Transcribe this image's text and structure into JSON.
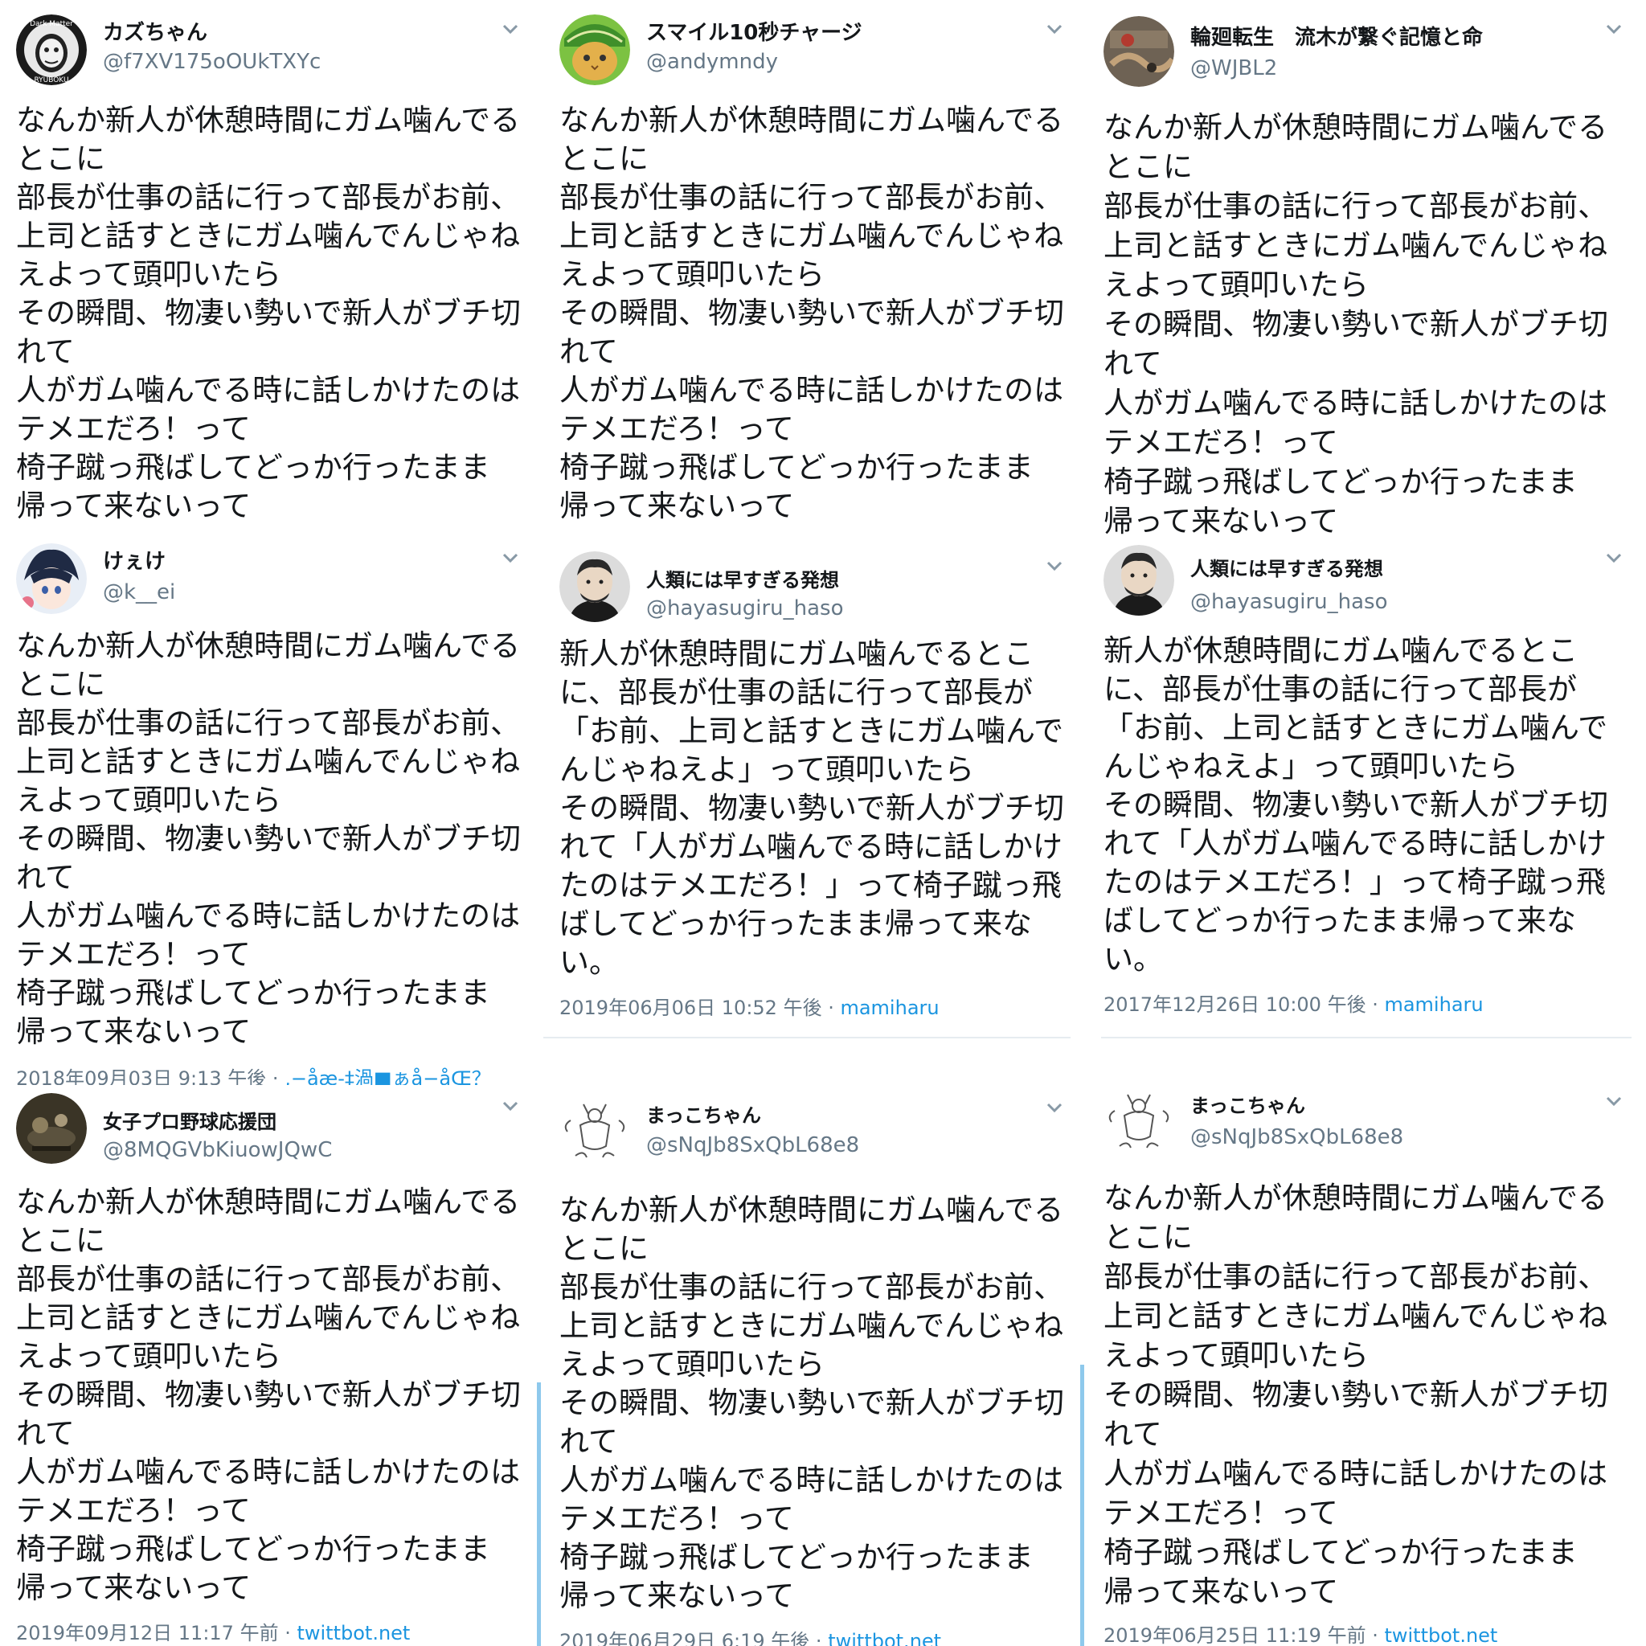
{
  "tweets": [
    {
      "user": "カズちゃん",
      "handle": "@f7XV175oOUkTXYc",
      "body": [
        "なんか新人が休憩時間にガム噛んでる",
        "とこに",
        "部長が仕事の話に行って部長がお前、",
        "上司と話すときにガム噛んでんじゃね",
        "えよって頭叩いたら",
        "その瞬間、物凄い勢いで新人がブチ切",
        "れて",
        "人がガム噛んでる時に話しかけたのは",
        "テメエだろ！って",
        "椅子蹴っ飛ばしてどっか行ったまま",
        "帰って来ないって"
      ],
      "timestamp": "",
      "source": "",
      "avatar_icon": "dark-mask-avatar-icon",
      "avatar_label": "Dark Matter",
      "avatar_sublabel": "RYUBOKU"
    },
    {
      "user": "スマイル10秒チャージ",
      "handle": "@andymndy",
      "body": [
        "なんか新人が休憩時間にガム噛んでる",
        "とこに",
        "部長が仕事の話に行って部長がお前、",
        "上司と話すときにガム噛んでんじゃね",
        "えよって頭叩いたら",
        "その瞬間、物凄い勢いで新人がブチ切",
        "れて",
        "人がガム噛んでる時に話しかけたのは",
        "テメエだろ！って",
        "椅子蹴っ飛ばしてどっか行ったまま",
        "帰って来ないって"
      ],
      "timestamp": "",
      "source": "",
      "avatar_icon": "melon-cat-avatar-icon"
    },
    {
      "user": "輪廻転生　流木が繋ぐ記憶と命",
      "handle": "@WJBL2",
      "body": [
        "なんか新人が休憩時間にガム噛んでる",
        "とこに",
        "部長が仕事の話に行って部長がお前、",
        "上司と話すときにガム噛んでんじゃね",
        "えよって頭叩いたら",
        "その瞬間、物凄い勢いで新人がブチ切",
        "れて",
        "人がガム噛んでる時に話しかけたのは",
        "テメエだろ！って",
        "椅子蹴っ飛ばしてどっか行ったまま",
        "帰って来ないって"
      ],
      "timestamp": "",
      "source": "",
      "avatar_icon": "driftwood-avatar-icon"
    },
    {
      "user": "けぇけ",
      "handle": "@k__ei",
      "body": [
        "なんか新人が休憩時間にガム噛んでる",
        "とこに",
        "部長が仕事の話に行って部長がお前、",
        "上司と話すときにガム噛んでんじゃね",
        "えよって頭叩いたら",
        "その瞬間、物凄い勢いで新人がブチ切",
        "れて",
        "人がガム噛んでる時に話しかけたのは",
        "テメエだろ！って",
        "椅子蹴っ飛ばしてどっか行ったまま",
        "帰って来ないって"
      ],
      "timestamp": "2018年09月03日 9:13 午後 · ",
      "source": ",−åæ-‡渦■ぁå−åŒ？",
      "avatar_icon": "anime-boy-avatar-icon"
    },
    {
      "user": "人類には早すぎる発想",
      "handle": "@hayasugiru_haso",
      "body": [
        "新人が休憩時間にガム噛んでるとこ",
        "に、部長が仕事の話に行って部長が",
        "「お前、上司と話すときにガム噛んで",
        "んじゃねえよ」って頭叩いたら",
        "その瞬間、物凄い勢いで新人がブチ切",
        "れて「人がガム噛んでる時に話しかけ",
        "たのはテメエだろ！」って椅子蹴っ飛",
        "ばしてどっか行ったまま帰って来な",
        "い。"
      ],
      "timestamp": "2019年06月06日 10:52 午後 · ",
      "source": "mamiharu",
      "avatar_icon": "nietzsche-portrait-avatar-icon"
    },
    {
      "user": "人類には早すぎる発想",
      "handle": "@hayasugiru_haso",
      "body": [
        "新人が休憩時間にガム噛んでるとこ",
        "に、部長が仕事の話に行って部長が",
        "「お前、上司と話すときにガム噛んで",
        "んじゃねえよ」って頭叩いたら",
        "その瞬間、物凄い勢いで新人がブチ切",
        "れて「人がガム噛んでる時に話しかけ",
        "たのはテメエだろ！」って椅子蹴っ飛",
        "ばしてどっか行ったまま帰って来な",
        "い。"
      ],
      "timestamp": "2017年12月26日 10:00 午後 · ",
      "source": "mamiharu",
      "avatar_icon": "nietzsche-portrait-avatar-icon"
    },
    {
      "user": "女子プロ野球応援団",
      "handle": "@8MQGVbKiuowJQwC",
      "body": [
        "なんか新人が休憩時間にガム噛んでる",
        "とこに",
        "部長が仕事の話に行って部長がお前、",
        "上司と話すときにガム噛んでんじゃね",
        "えよって頭叩いたら",
        "その瞬間、物凄い勢いで新人がブチ切",
        "れて",
        "人がガム噛んでる時に話しかけたのは",
        "テメエだろ！って",
        "椅子蹴っ飛ばしてどっか行ったまま",
        "帰って来ないって"
      ],
      "timestamp": "2019年09月12日 11:17 午前 · ",
      "source": "twittbot.net",
      "avatar_icon": "baseball-avatar-icon"
    },
    {
      "user": "まっこちゃん",
      "handle": "@sNqJb8SxQbL68e8",
      "body": [
        "なんか新人が休憩時間にガム噛んでる",
        "とこに",
        "部長が仕事の話に行って部長がお前、",
        "上司と話すときにガム噛んでんじゃね",
        "えよって頭叩いたら",
        "その瞬間、物凄い勢いで新人がブチ切",
        "れて",
        "人がガム噛んでる時に話しかけたのは",
        "テメエだろ！って",
        "椅子蹴っ飛ばしてどっか行ったまま",
        "帰って来ないって"
      ],
      "timestamp": "2019年06月29日 6:19 午後 · ",
      "source": "twittbot.net",
      "avatar_icon": "sketch-figure-avatar-icon"
    },
    {
      "user": "まっこちゃん",
      "handle": "@sNqJb8SxQbL68e8",
      "body": [
        "なんか新人が休憩時間にガム噛んでる",
        "とこに",
        "部長が仕事の話に行って部長がお前、",
        "上司と話すときにガム噛んでんじゃね",
        "えよって頭叩いたら",
        "その瞬間、物凄い勢いで新人がブチ切",
        "れて",
        "人がガム噛んでる時に話しかけたのは",
        "テメエだろ！って",
        "椅子蹴っ飛ばしてどっか行ったまま",
        "帰って来ないって"
      ],
      "timestamp": "2019年06月25日 11:19 午前 · ",
      "source": "twittbot.net",
      "avatar_icon": "sketch-figure-avatar-icon"
    }
  ],
  "colors": {
    "text": "#14171a",
    "muted": "#657786",
    "link": "#1b95e0",
    "thread": "#8ec9ec",
    "divider": "#e6ecf0"
  }
}
